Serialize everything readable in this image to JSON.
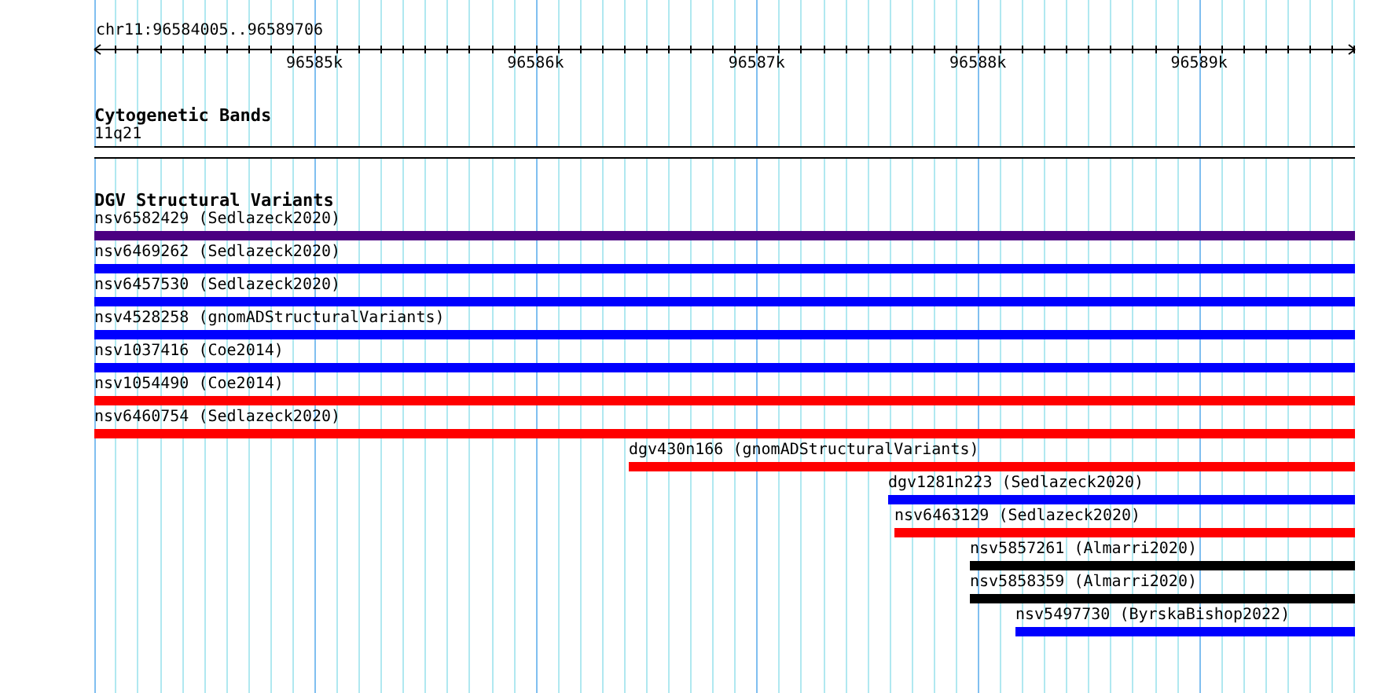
{
  "ruler": {
    "location": "chr11:96584005..96589706",
    "ticks": [
      "96585k",
      "96586k",
      "96587k",
      "96588k",
      "96589k"
    ]
  },
  "cytoband_track": {
    "title": "Cytogenetic Bands",
    "band": {
      "label": "11q21"
    }
  },
  "variant_track": {
    "title": "DGV Structural Variants",
    "features": [
      {
        "label": "nsv6582429 (Sedlazeck2020)",
        "color": "#4b0082"
      },
      {
        "label": "nsv6469262 (Sedlazeck2020)",
        "color": "#0000ff"
      },
      {
        "label": "nsv6457530 (Sedlazeck2020)",
        "color": "#0000ff"
      },
      {
        "label": "nsv4528258 (gnomADStructuralVariants)",
        "color": "#0000ff"
      },
      {
        "label": "nsv1037416 (Coe2014)",
        "color": "#0000ff"
      },
      {
        "label": "nsv1054490 (Coe2014)",
        "color": "#ff0000"
      },
      {
        "label": "nsv6460754 (Sedlazeck2020)",
        "color": "#ff0000"
      },
      {
        "label": "dgv430n166 (gnomADStructuralVariants)",
        "color": "#ff0000"
      },
      {
        "label": "dgv1281n223 (Sedlazeck2020)",
        "color": "#0000ff"
      },
      {
        "label": "nsv6463129 (Sedlazeck2020)",
        "color": "#ff0000"
      },
      {
        "label": "nsv5857261 (Almarri2020)",
        "color": "#000000"
      },
      {
        "label": "nsv5858359 (Almarri2020)",
        "color": "#000000"
      },
      {
        "label": "nsv5497730 (ByrskaBishop2022)",
        "color": "#0000ff"
      }
    ]
  }
}
